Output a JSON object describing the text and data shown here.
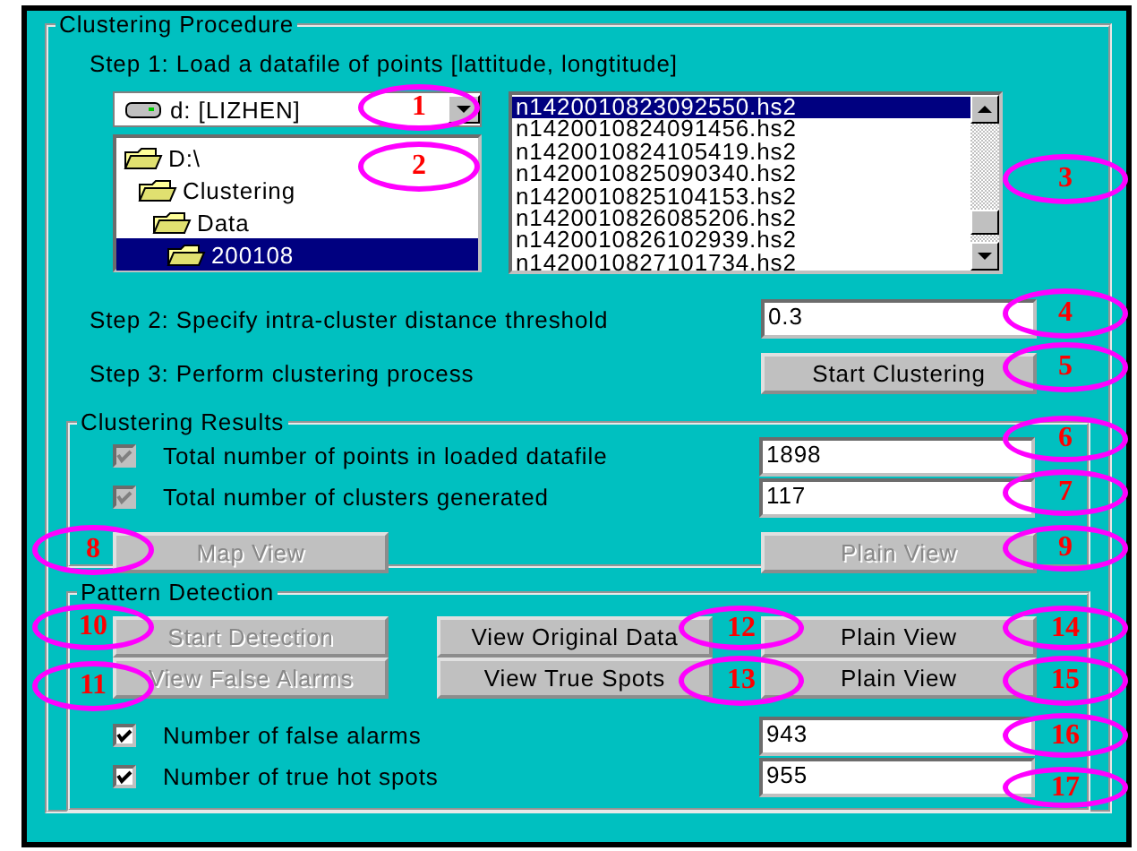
{
  "procedure": {
    "title": "Clustering Procedure"
  },
  "step1": {
    "label": "Step 1: Load a datafile of points [lattitude, longtitude]"
  },
  "drive": {
    "value": "d: [LIZHEN]"
  },
  "folders": [
    {
      "label": "D:\\",
      "selected": false,
      "children": [
        {
          "label": "Clustering",
          "selected": false,
          "children": [
            {
              "label": "Data",
              "selected": false,
              "children": [
                {
                  "label": "200108",
                  "selected": true
                }
              ]
            }
          ]
        }
      ]
    }
  ],
  "files": [
    {
      "name": "n1420010823092550.hs2",
      "selected": true
    },
    {
      "name": "n1420010824091456.hs2",
      "selected": false
    },
    {
      "name": "n1420010824105419.hs2",
      "selected": false
    },
    {
      "name": "n1420010825090340.hs2",
      "selected": false
    },
    {
      "name": "n1420010825104153.hs2",
      "selected": false
    },
    {
      "name": "n1420010826085206.hs2",
      "selected": false
    },
    {
      "name": "n1420010826102939.hs2",
      "selected": false
    },
    {
      "name": "n1420010827101734.hs2",
      "selected": false
    }
  ],
  "step2": {
    "label": "Step 2: Specify intra-cluster distance threshold",
    "value": "0.3"
  },
  "step3": {
    "label": "Step 3: Perform clustering process",
    "button": "Start Clustering"
  },
  "results": {
    "title": "Clustering Results",
    "stats": [
      {
        "label": "Total number of points in loaded datafile",
        "checked": true,
        "disabled": true,
        "value": "1898"
      },
      {
        "label": "Total number of clusters generated",
        "checked": true,
        "disabled": true,
        "value": "117"
      }
    ],
    "buttons": [
      {
        "label": "Map View",
        "disabled": true
      },
      {
        "label": "Plain View",
        "disabled": true
      }
    ]
  },
  "pattern": {
    "title": "Pattern Detection",
    "button_rows": [
      [
        {
          "label": "Start Detection",
          "disabled": true
        },
        {
          "label": "View Original Data",
          "disabled": false
        },
        {
          "label": "Plain View",
          "disabled": false
        }
      ],
      [
        {
          "label": "View False Alarms",
          "disabled": true
        },
        {
          "label": "View True Spots",
          "disabled": false
        },
        {
          "label": "Plain View",
          "disabled": false
        }
      ]
    ],
    "stats": [
      {
        "label": "Number of false alarms",
        "checked": true,
        "disabled": false,
        "value": "943"
      },
      {
        "label": "Number of true hot spots",
        "checked": true,
        "disabled": false,
        "value": "955"
      }
    ]
  },
  "callouts": [
    "1",
    "2",
    "3",
    "4",
    "5",
    "6",
    "7",
    "8",
    "9",
    "10",
    "11",
    "12",
    "13",
    "14",
    "15",
    "16",
    "17"
  ]
}
